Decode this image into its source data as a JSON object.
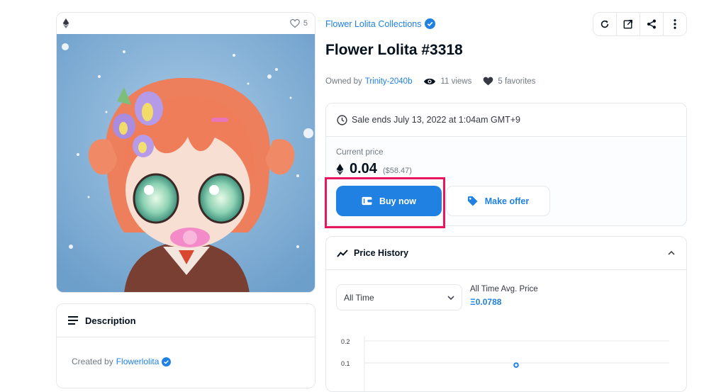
{
  "media": {
    "favorites_count": "5",
    "image_alt": "Flower Lolita character art"
  },
  "description": {
    "heading": "Description",
    "created_by_prefix": "Created by",
    "creator": "Flowerlolita"
  },
  "collection": {
    "name": "Flower Lolita Collections",
    "verified": true
  },
  "toolbar": {
    "icons": [
      "refresh-icon",
      "external-link-icon",
      "share-icon",
      "more-options-icon"
    ]
  },
  "item": {
    "title": "Flower Lolita #3318",
    "owned_by_prefix": "Owned by",
    "owner": "Trinity-2040b",
    "views": "11 views",
    "favorites": "5 favorites"
  },
  "sale": {
    "ends_text": "Sale ends July 13, 2022 at 1:04am GMT+9",
    "current_price_label": "Current price",
    "price": "0.04",
    "price_usd": "($58.47)",
    "buy_label": "Buy now",
    "offer_label": "Make offer"
  },
  "price_history": {
    "heading": "Price History",
    "range_selected": "All Time",
    "avg_label": "All Time Avg. Price",
    "avg_value": "Ξ0.0788"
  },
  "chart_data": {
    "type": "scatter",
    "y_ticks": [
      "0.2",
      "0.1"
    ],
    "ylim": [
      0,
      0.2
    ],
    "points": [
      {
        "y": 0.09
      }
    ]
  },
  "colors": {
    "accent": "#2081e2",
    "highlight": "#e8175d",
    "text": "#04111d",
    "muted": "#707a83"
  }
}
